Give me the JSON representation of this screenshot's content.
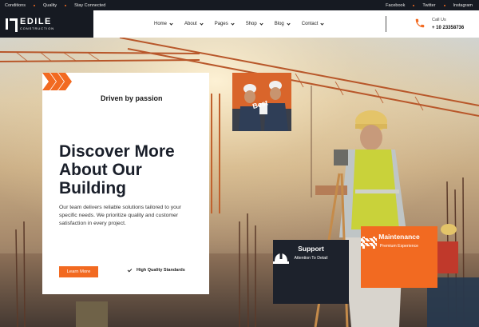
{
  "topbar": {
    "left_links": [
      "Conditions",
      "Quality",
      "Stay Connected"
    ],
    "right_links": [
      "Facebook",
      "Twitter",
      "Instagram"
    ]
  },
  "brand": {
    "name": "EDILE",
    "tagline": "CONSTRUCTION"
  },
  "nav": {
    "items": [
      "Home",
      "About",
      "Pages",
      "Shop",
      "Blog",
      "Contact"
    ]
  },
  "contact": {
    "label": "Call Us",
    "number": "+ 10 23358736",
    "icon": "phone-icon"
  },
  "hero": {
    "tagline": "Driven by passion",
    "headline": "Discover More About Our Building",
    "description": "Our team delivers reliable solutions tailored to your specific needs. We prioritize quality and customer satisfaction in every project.",
    "cta_label": "Learn More",
    "badge": "High Quality Standards"
  },
  "photo": {
    "caption": "Best"
  },
  "services": [
    {
      "title": "Support",
      "subtitle": "Attention To Detail",
      "icon": "hardhat-icon"
    },
    {
      "title": "Maintenance",
      "subtitle": "Premium Experience",
      "icon": "barrier-icon"
    }
  ],
  "colors": {
    "accent": "#f26a21",
    "dark": "#1d222c",
    "topbar": "#161a22"
  }
}
